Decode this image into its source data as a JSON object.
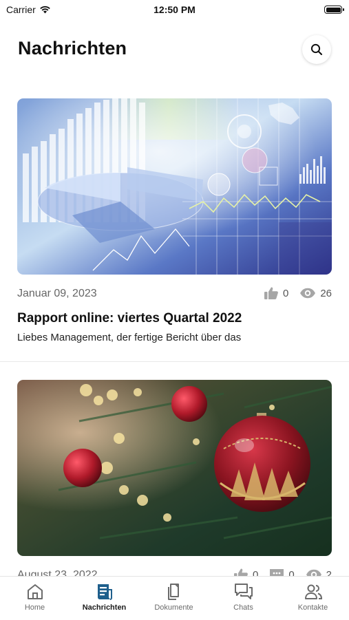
{
  "status_bar": {
    "carrier": "Carrier",
    "time": "12:50 PM"
  },
  "header": {
    "title": "Nachrichten",
    "search_icon": "search-icon"
  },
  "feed": {
    "articles": [
      {
        "date": "Januar 09, 2023",
        "likes": "0",
        "views": "26",
        "title": "Rapport online: viertes Quartal 2022",
        "excerpt": "Liebes Management, der fertige Bericht über das",
        "image": "business-charts-image"
      },
      {
        "date": "August 23, 2022",
        "likes": "0",
        "comments": "0",
        "views": "2",
        "image": "christmas-ornament-image"
      }
    ]
  },
  "tab_bar": {
    "active_color": "#1e5f8c",
    "items": [
      {
        "label": "Home",
        "icon": "home-icon"
      },
      {
        "label": "Nachrichten",
        "icon": "news-icon",
        "active": true
      },
      {
        "label": "Dokumente",
        "icon": "documents-icon"
      },
      {
        "label": "Chats",
        "icon": "chats-icon"
      },
      {
        "label": "Kontakte",
        "icon": "contacts-icon"
      }
    ]
  }
}
